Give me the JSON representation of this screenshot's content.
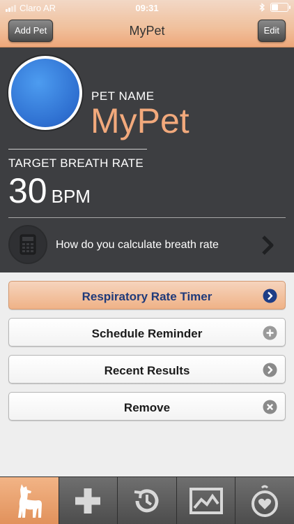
{
  "status": {
    "carrier": "Claro AR",
    "time": "09:31"
  },
  "nav": {
    "left_button": "Add Pet",
    "title": "MyPet",
    "right_button": "Edit"
  },
  "pet": {
    "name_label": "PET NAME",
    "name": "MyPet",
    "target_label": "TARGET BREATH RATE",
    "target_value": "30",
    "target_unit": "BPM"
  },
  "calc": {
    "text": "How do you calculate breath rate",
    "icon": "calculator-icon"
  },
  "actions": [
    {
      "label": "Respiratory Rate Timer",
      "icon": "chevron-right-circle-icon"
    },
    {
      "label": "Schedule Reminder",
      "icon": "plus-circle-icon"
    },
    {
      "label": "Recent Results",
      "icon": "chevron-right-circle-icon"
    },
    {
      "label": "Remove",
      "icon": "close-circle-icon"
    }
  ],
  "tabs": [
    {
      "icon": "dog-icon",
      "active": true
    },
    {
      "icon": "plus-icon",
      "active": false
    },
    {
      "icon": "history-timer-icon",
      "active": false
    },
    {
      "icon": "chart-icon",
      "active": false
    },
    {
      "icon": "heart-tag-icon",
      "active": false
    }
  ],
  "colors": {
    "accent": "#f2a97c",
    "panel": "#3d3e41",
    "primary_text": "#1f3a7a",
    "avatar": "#3f86e6"
  }
}
